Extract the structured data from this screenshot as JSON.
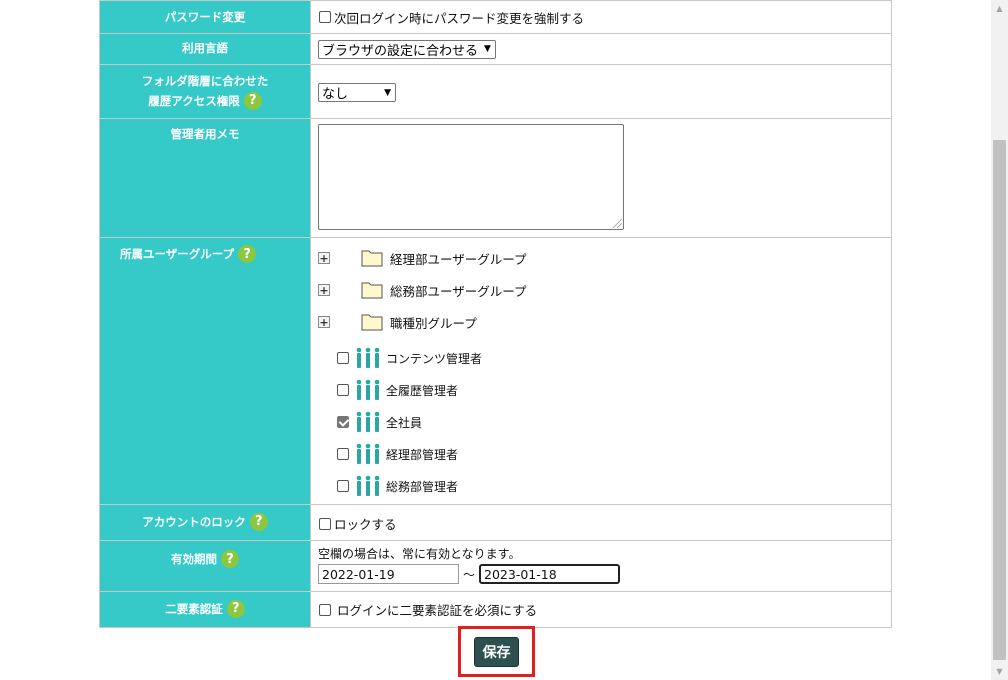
{
  "password_change": {
    "label": "パスワード変更",
    "checkbox_label": "次回ログイン時にパスワード変更を強制する",
    "checked": false
  },
  "language": {
    "label": "利用言語",
    "selected": "ブラウザの設定に合わせる"
  },
  "folder_access": {
    "label_line1": "フォルダ階層に合わせた",
    "label_line2": "履歴アクセス権限",
    "selected": "なし"
  },
  "admin_memo": {
    "label": "管理者用メモ",
    "value": ""
  },
  "user_groups": {
    "label": "所属ユーザーグループ",
    "folders": [
      {
        "icon": "plus-expand-icon",
        "name": "経理部ユーザーグループ"
      },
      {
        "icon": "plus-expand-icon",
        "name": "総務部ユーザーグループ"
      },
      {
        "icon": "plus-expand-icon",
        "name": "職種別グループ"
      }
    ],
    "groups": [
      {
        "name": "コンテンツ管理者",
        "checked": false
      },
      {
        "name": "全履歴管理者",
        "checked": false
      },
      {
        "name": "全社員",
        "checked": true
      },
      {
        "name": "経理部管理者",
        "checked": false
      },
      {
        "name": "総務部管理者",
        "checked": false
      }
    ]
  },
  "account_lock": {
    "label": "アカウントのロック",
    "checkbox_label": "ロックする",
    "checked": false
  },
  "validity": {
    "label": "有効期間",
    "note": "空欄の場合は、常に有効となります。",
    "start": "2022-01-19",
    "separator": "～",
    "end": "2023-01-18"
  },
  "two_factor": {
    "label": "二要素認証",
    "checkbox_label": "ログインに二要素認証を必須にする",
    "checked": false
  },
  "save_button": {
    "label": "保存"
  },
  "help_icon_glyph": "?",
  "colors": {
    "label_bg": "#35c9c8",
    "help_icon": "#8dc63f",
    "save_button": "#2f5050",
    "highlight_box": "#e0201f",
    "group_icon": "#2aa7a3",
    "folder_fill": "#fff8cc"
  }
}
